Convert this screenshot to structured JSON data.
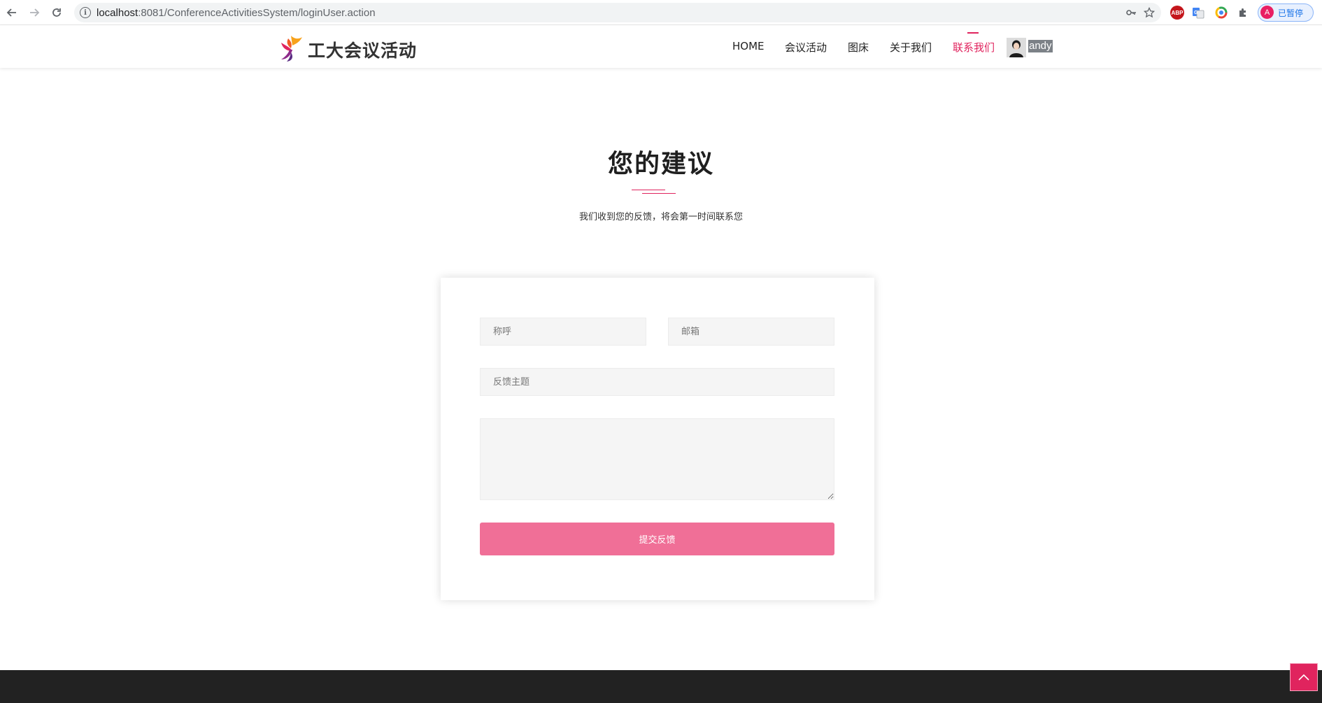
{
  "browser": {
    "url_host": "localhost",
    "url_path": ":8081/ConferenceActivitiesSystem/loginUser.action",
    "back_icon": "arrow-left-icon",
    "forward_icon": "arrow-right-icon",
    "reload_icon": "reload-icon",
    "profile_initial": "A",
    "profile_label": "已暂停",
    "extensions": [
      "key-icon",
      "star-icon",
      "abp-icon",
      "translate-icon",
      "chrome-color-icon",
      "puzzle-icon"
    ],
    "abp_label": "ABP"
  },
  "header": {
    "logo_text": "工大会议活动",
    "menu": [
      {
        "label": "HOME"
      },
      {
        "label": "会议活动"
      },
      {
        "label": "图床"
      },
      {
        "label": "关于我们"
      },
      {
        "label": "联系我们",
        "active": true
      }
    ],
    "user_name": "andy"
  },
  "main": {
    "title": "您的建议",
    "subtitle": "我们收到您的反馈，将会第一时间联系您"
  },
  "form": {
    "name_placeholder": "称呼",
    "email_placeholder": "邮箱",
    "subject_placeholder": "反馈主题",
    "message_placeholder": "",
    "submit_label": "提交反馈"
  },
  "colors": {
    "accent": "#e0245e",
    "button": "#f06f97",
    "footer": "#222222"
  }
}
